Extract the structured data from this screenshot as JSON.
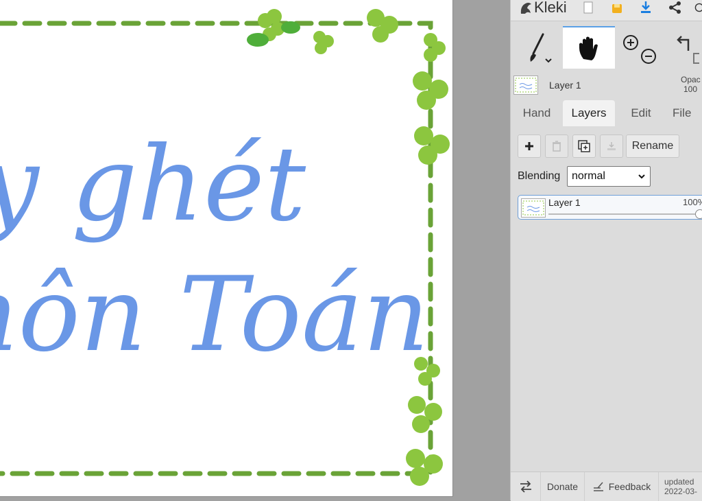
{
  "app": {
    "name": "Kleki"
  },
  "canvas": {
    "text_line1": "y ghét",
    "text_line2": "nôn Toán",
    "text_color": "#6a97e6",
    "border_color": "#6aa337",
    "clover_colors": [
      "#8cc63f",
      "#4fae3a"
    ]
  },
  "toolbar": {
    "brush_icon": "brush-icon",
    "hand_icon": "hand-icon",
    "zoom_in_icon": "zoom-in-icon",
    "zoom_out_icon": "zoom-out-icon",
    "undo_icon": "undo-icon"
  },
  "top_layer_preview": {
    "name": "Layer 1",
    "opacity_label": "Opac",
    "opacity_value": "100"
  },
  "tabs": [
    {
      "label": "Hand"
    },
    {
      "label": "Layers"
    },
    {
      "label": "Edit"
    },
    {
      "label": "File"
    }
  ],
  "layers_panel": {
    "rename_label": "Rename",
    "blending_label": "Blending",
    "blending_value": "normal",
    "layers": [
      {
        "name": "Layer 1",
        "opacity": "100%"
      }
    ]
  },
  "bottom_bar": {
    "donate_label": "Donate",
    "feedback_label": "Feedback",
    "updated_label": "updated",
    "updated_date": "2022-03-"
  },
  "colors": {
    "accent": "#5aa0e6",
    "panel_bg": "#dcdcdc",
    "workspace_bg": "#a1a1a1"
  }
}
